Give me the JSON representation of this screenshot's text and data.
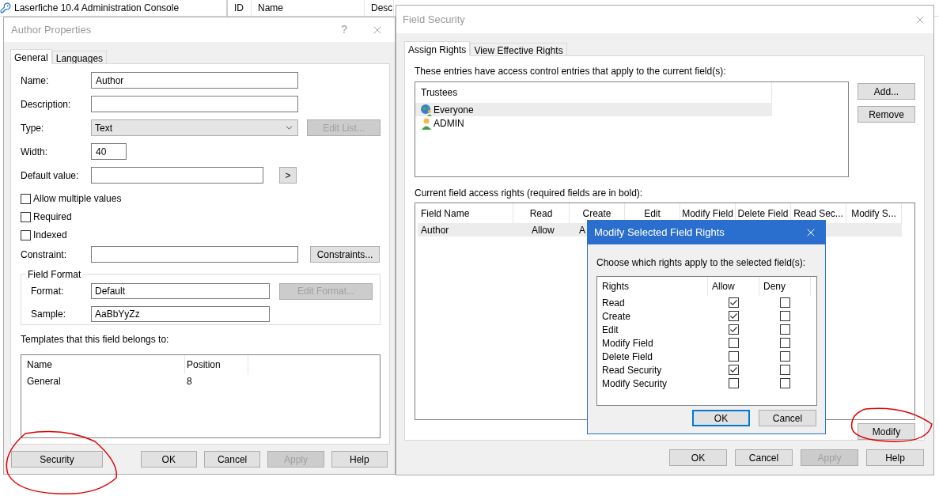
{
  "background": {
    "title": "Laserfiche 10.4 Administration Console",
    "columns": [
      "ID",
      "Name",
      "Desc"
    ]
  },
  "author_dialog": {
    "title": "Author Properties",
    "help": "?",
    "tabs": [
      {
        "label": "General",
        "selected": true
      },
      {
        "label": "Languages",
        "selected": false
      }
    ],
    "fields": [
      {
        "label": "Name:",
        "kind": "text",
        "value": "Author"
      },
      {
        "label": "Description:",
        "kind": "text"
      },
      {
        "label": "Type:",
        "kind": "select",
        "value": "Text",
        "button": {
          "label": "Edit List...",
          "disabled": true
        }
      },
      {
        "label": "Width:",
        "kind": "short",
        "value": "40"
      },
      {
        "label": "Default value:",
        "kind": "narrow",
        "button": {
          "label": ">",
          "disabled": false
        }
      }
    ],
    "checkboxes": [
      {
        "label": "Allow multiple values",
        "checked": false
      },
      {
        "label": "Required",
        "checked": false
      },
      {
        "label": "Indexed",
        "checked": false
      }
    ],
    "constraint": {
      "label": "Constraint:",
      "button": {
        "label": "Constraints...",
        "disabled": false
      }
    },
    "field_format": {
      "title": "Field Format",
      "format_label": "Format:",
      "format_value": "Default",
      "edit_button": {
        "label": "Edit Format...",
        "disabled": true
      },
      "sample_label": "Sample:",
      "sample_value": "AaBbYyZz"
    },
    "templates": {
      "label": "Templates that this field belongs to:",
      "columns": [
        "Name",
        "Position"
      ],
      "rows": [
        [
          "General",
          "8"
        ]
      ]
    },
    "security_button": "Security",
    "buttons": [
      {
        "label": "OK",
        "disabled": false
      },
      {
        "label": "Cancel",
        "disabled": false
      },
      {
        "label": "Apply",
        "disabled": true
      },
      {
        "label": "Help",
        "disabled": false
      }
    ]
  },
  "field_security": {
    "title": "Field Security",
    "tabs": [
      {
        "label": "Assign Rights",
        "selected": true
      },
      {
        "label": "View Effective Rights",
        "selected": false
      }
    ],
    "trustees_caption": "These entries have access control entries that apply to the current field(s):",
    "trustees": {
      "column": "Trustees",
      "items": [
        {
          "name": "Everyone",
          "kind": "group",
          "selected": true
        },
        {
          "name": "ADMIN",
          "kind": "user",
          "selected": false
        }
      ]
    },
    "side_buttons": [
      "Add...",
      "Remove"
    ],
    "rights_caption": "Current field access rights (required fields are in bold):",
    "rights_table": {
      "columns": [
        "Field Name",
        "Read",
        "Create",
        "Edit",
        "Modify Field",
        "Delete Field",
        "Read Sec...",
        "Modify S..."
      ],
      "rows": [
        {
          "cells": [
            "Author",
            "Allow",
            "A"
          ],
          "selected": true
        }
      ]
    },
    "modify_button": "Modify",
    "buttons": [
      {
        "label": "OK",
        "disabled": false
      },
      {
        "label": "Cancel",
        "disabled": false
      },
      {
        "label": "Apply",
        "disabled": true
      },
      {
        "label": "Help",
        "disabled": false
      }
    ]
  },
  "modify_dialog": {
    "title": "Modify Selected Field Rights",
    "caption": "Choose which rights apply to the selected field(s):",
    "columns": [
      "Rights",
      "Allow",
      "Deny"
    ],
    "rows": [
      {
        "name": "Read",
        "allow": true,
        "deny": false
      },
      {
        "name": "Create",
        "allow": true,
        "deny": false
      },
      {
        "name": "Edit",
        "allow": true,
        "deny": false
      },
      {
        "name": "Modify Field",
        "allow": false,
        "deny": false
      },
      {
        "name": "Delete Field",
        "allow": false,
        "deny": false
      },
      {
        "name": "Read Security",
        "allow": true,
        "deny": false
      },
      {
        "name": "Modify Security",
        "allow": false,
        "deny": false
      }
    ],
    "buttons": [
      {
        "label": "OK",
        "default": true
      },
      {
        "label": "Cancel",
        "default": false
      }
    ]
  }
}
